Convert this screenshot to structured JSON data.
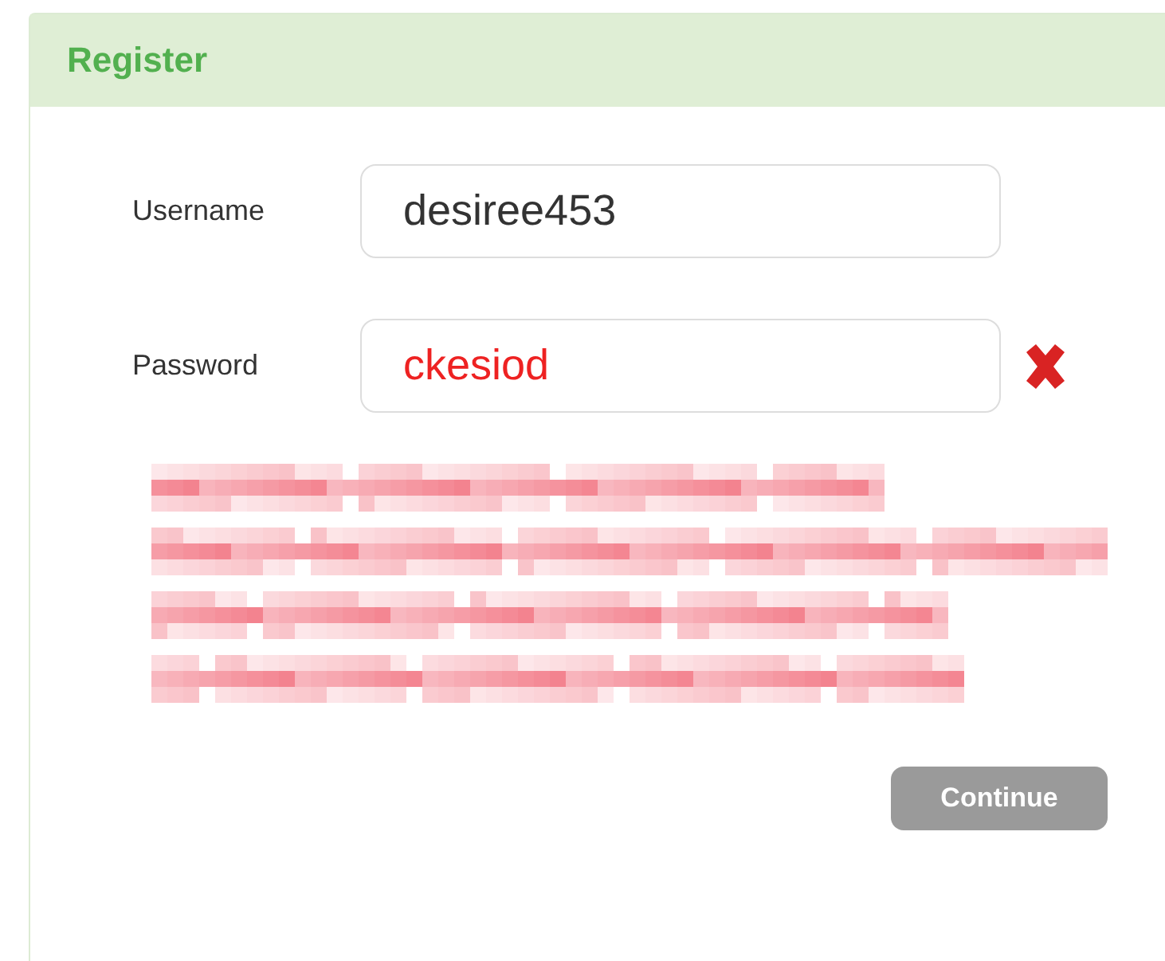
{
  "panel": {
    "title": "Register"
  },
  "fields": [
    {
      "label": "Username",
      "value": "desiree453",
      "invalid": false
    },
    {
      "label": "Password",
      "value": "ckesiod",
      "invalid": true
    }
  ],
  "buttons": [
    {
      "label": "Continue",
      "disabled": true
    }
  ]
}
